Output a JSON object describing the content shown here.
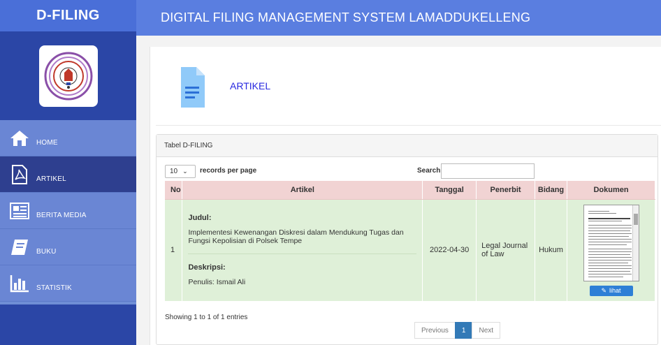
{
  "app": {
    "brand": "D-FILING",
    "title": "DIGITAL FILING MANAGEMENT SYSTEM LAMADDUKELLENG"
  },
  "sidebar": {
    "items": [
      {
        "label": "HOME",
        "icon": "home-icon",
        "active": false
      },
      {
        "label": "ARTIKEL",
        "icon": "pdf-file-icon",
        "active": true
      },
      {
        "label": "BERITA MEDIA",
        "icon": "newspaper-icon",
        "active": false
      },
      {
        "label": "BUKU",
        "icon": "book-icon",
        "active": false
      },
      {
        "label": "STATISTIK",
        "icon": "bar-chart-icon",
        "active": false
      }
    ]
  },
  "page": {
    "title": "ARTIKEL",
    "icon": "document-icon"
  },
  "panel": {
    "heading": "Tabel D-FILING",
    "length_value": "10",
    "length_label": "records per page",
    "search_label": "Search:",
    "search_value": ""
  },
  "table": {
    "headers": [
      "No",
      "Artikel",
      "Tanggal",
      "Penerbit",
      "Bidang",
      "Dokumen"
    ],
    "rows": [
      {
        "no": "1",
        "judul_label": "Judul:",
        "judul": "Implementesi Kewenangan Diskresi dalam Mendukung Tugas dan Fungsi Kepolisian di Polsek Tempe",
        "deskripsi_label": "Deskripsi:",
        "deskripsi": "Penulis: Ismail Ali",
        "tanggal": "2022-04-30",
        "penerbit": "Legal Journal of Law",
        "bidang": "Hukum",
        "button": "lihat"
      }
    ]
  },
  "footer": {
    "info": "Showing 1 to 1 of 1 entries",
    "prev": "Previous",
    "page": "1",
    "next": "Next"
  },
  "colors": {
    "sidebar": "#6f8ed6",
    "active": "#2e3f8f",
    "header": "#5a7ee0",
    "table_head": "#f1d3d3",
    "row": "#dff0d8",
    "title_link": "#2828e0"
  }
}
